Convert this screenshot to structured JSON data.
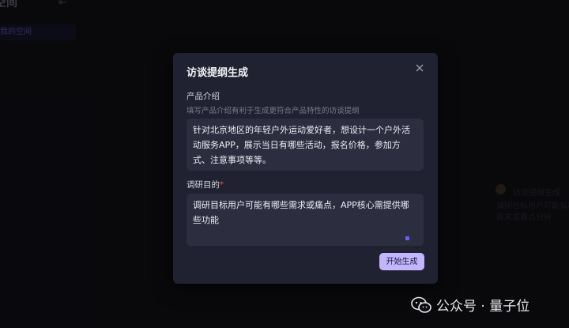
{
  "background": {
    "header_title": "空间",
    "nav_item": "我的空间",
    "faint_texts": [
      "访谈提纲生成",
      "调研目标用户可能有哪些",
      "需求或痛点分析"
    ],
    "colors": {
      "base": "#111117",
      "nav_highlight": "#15172a"
    }
  },
  "modal": {
    "title": "访谈提纲生成",
    "product_intro": {
      "label": "产品介绍",
      "hint": "填写产品介绍有利于生成更符合产品特性的访谈提纲",
      "value": "针对北京地区的年轻户外运动爱好者，想设计一个户外活动服务APP，展示当日有哪些活动，报名价格，参加方式、注意事项等等。"
    },
    "research_goal": {
      "label": "调研目的",
      "required_mark": "*",
      "value": "调研目标用户可能有哪些需求或痛点，APP核心需提供哪些功能"
    },
    "start_button": "开始生成",
    "colors": {
      "panel": "#202232",
      "field": "#2c2e40",
      "button": "#c3b6ff",
      "accent": "#6b5cff"
    }
  },
  "watermark": {
    "text": "公众号 · 量子位",
    "icon": "wechat-icon"
  }
}
